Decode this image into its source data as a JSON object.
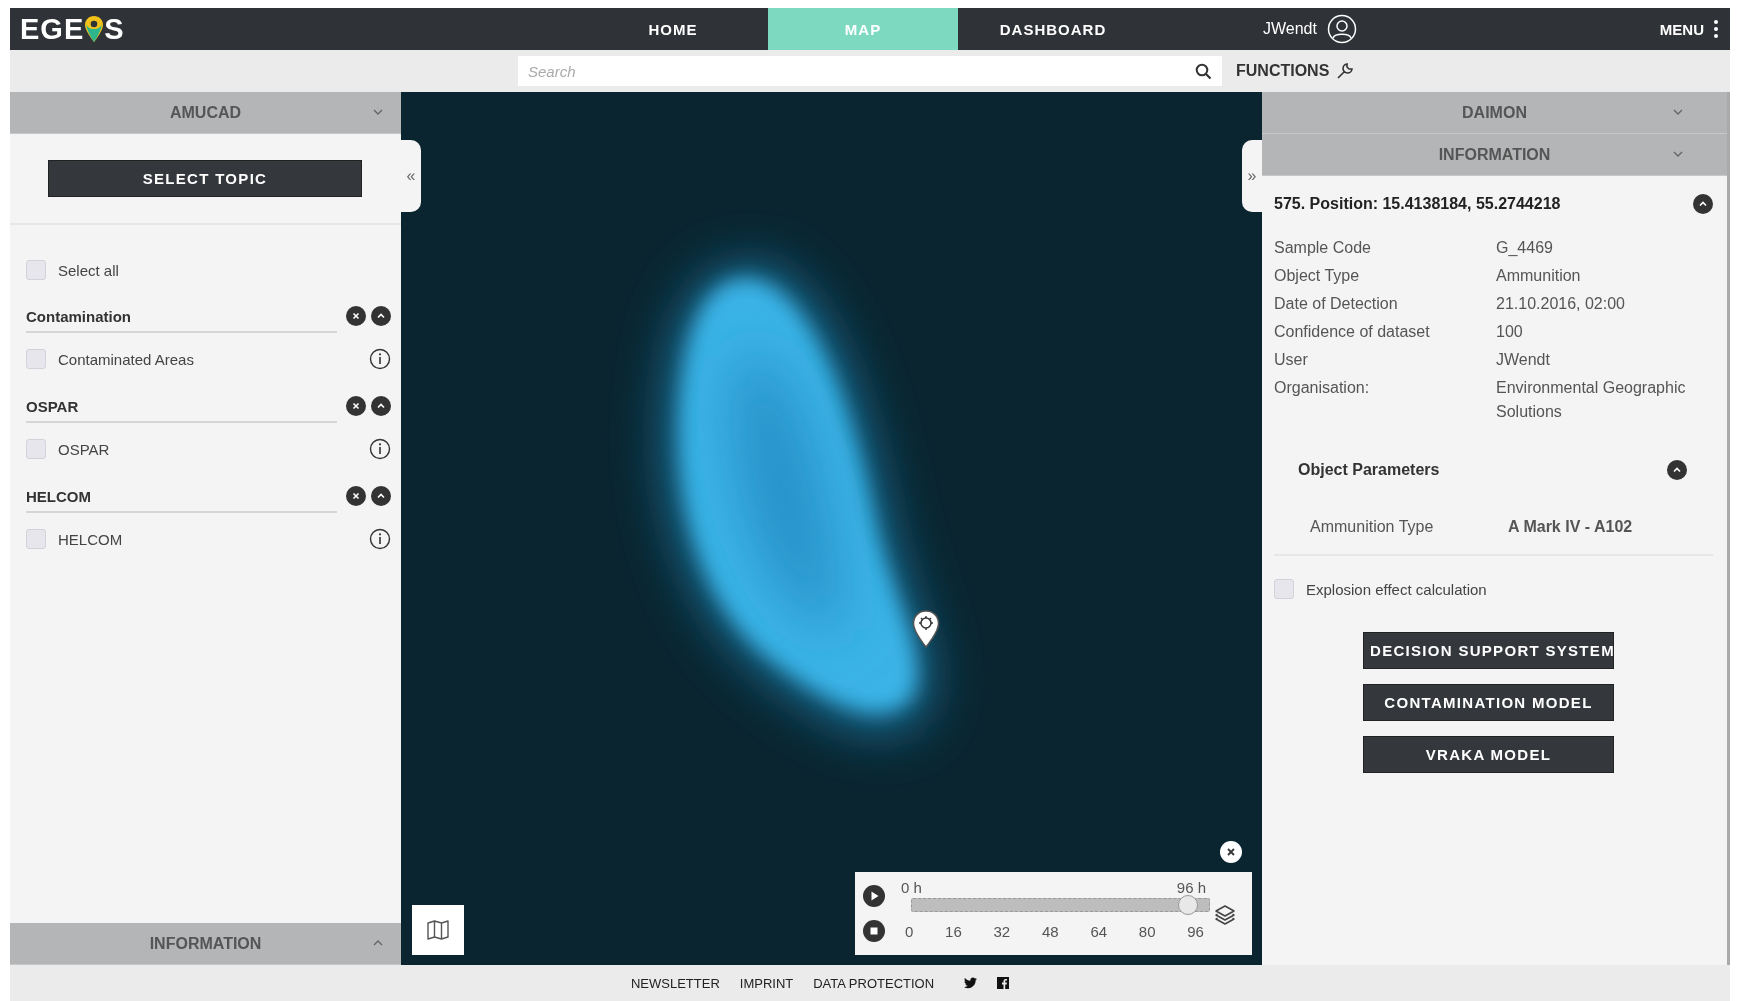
{
  "header": {
    "logo": {
      "before": "EGE",
      "after": "S"
    },
    "nav": [
      {
        "label": "HOME",
        "selected": false
      },
      {
        "label": "MAP",
        "selected": true
      },
      {
        "label": "DASHBOARD",
        "selected": false
      }
    ],
    "user": "JWendt",
    "menu": "MENU"
  },
  "toolbar": {
    "search": {
      "placeholder": "Search"
    },
    "functions": "FUNCTIONS"
  },
  "left_panel": {
    "title": "AMUCAD",
    "select_topic": "SELECT TOPIC",
    "select_all": {
      "label": "Select all",
      "checked": false
    },
    "groups": [
      {
        "title": "Contamination",
        "expanded": true,
        "items": [
          {
            "label": "Contaminated Areas",
            "checked": false
          }
        ]
      },
      {
        "title": "OSPAR",
        "expanded": true,
        "items": [
          {
            "label": "OSPAR",
            "checked": false
          }
        ]
      },
      {
        "title": "HELCOM",
        "expanded": true,
        "items": [
          {
            "label": "HELCOM",
            "checked": false
          }
        ]
      }
    ],
    "bottom_title": "INFORMATION"
  },
  "map": {
    "left_toggle": "«",
    "right_toggle": "»",
    "timeline": {
      "start": "0 h",
      "end": "96 h",
      "level": 0.93,
      "ticks": [
        "0",
        "16",
        "32",
        "48",
        "64",
        "80",
        "96"
      ]
    }
  },
  "right_panel": {
    "title": "DAIMON",
    "section": "INFORMATION",
    "detail": {
      "title": "575. Position: 15.4138184, 55.2744218",
      "expanded": true,
      "rows": [
        {
          "label": "Sample Code",
          "value": "G_4469"
        },
        {
          "label": "Object Type",
          "value": "Ammunition"
        },
        {
          "label": "Date of Detection",
          "value": "21.10.2016, 02:00"
        },
        {
          "label": "Confidence of dataset",
          "value": "100"
        },
        {
          "label": "User",
          "value": "JWendt"
        },
        {
          "label": "Organisation:",
          "value": "Environmental Geographic Solutions"
        }
      ],
      "parameters": {
        "title": "Object Parameters",
        "expanded": true,
        "rows": [
          {
            "label": "Ammunition Type",
            "value": "A Mark IV - A102"
          }
        ]
      }
    },
    "explosion": {
      "label": "Explosion effect calculation",
      "checked": false
    },
    "buttons": [
      "DECISION SUPPORT SYSTEM",
      "CONTAMINATION MODEL",
      "VRAKA MODEL"
    ]
  },
  "footer": {
    "links": [
      "NEWSLETTER",
      "IMPRINT",
      "DATA PROTECTION"
    ]
  }
}
